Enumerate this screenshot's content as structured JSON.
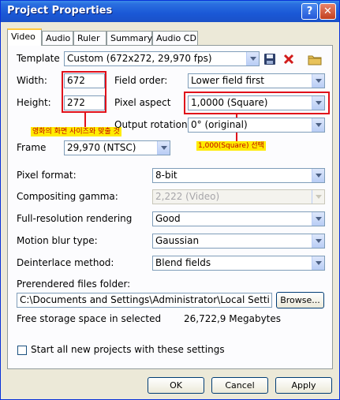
{
  "window": {
    "title": "Project Properties",
    "help_glyph": "?",
    "close_glyph": "✕"
  },
  "tabs": [
    "Video",
    "Audio",
    "Ruler",
    "Summary",
    "Audio CD"
  ],
  "template": {
    "label": "Template",
    "value": "Custom (672x272, 29,970 fps)"
  },
  "width": {
    "label": "Width:",
    "value": "672"
  },
  "height": {
    "label": "Height:",
    "value": "272"
  },
  "field_order": {
    "label": "Field order:",
    "value": "Lower field first"
  },
  "pixel_aspect": {
    "label": "Pixel aspect",
    "value": "1,0000 (Square)"
  },
  "output_rotation": {
    "label": "Output rotation:",
    "value": "0° (original)"
  },
  "frame": {
    "label": "Frame",
    "value": "29,970 (NTSC)"
  },
  "pixel_format": {
    "label": "Pixel format:",
    "value": "8-bit"
  },
  "compositing_gamma": {
    "label": "Compositing gamma:",
    "value": "2,222 (Video)"
  },
  "full_resolution": {
    "label": "Full-resolution rendering",
    "value": "Good"
  },
  "motion_blur": {
    "label": "Motion blur type:",
    "value": "Gaussian"
  },
  "deinterlace": {
    "label": "Deinterlace method:",
    "value": "Blend fields"
  },
  "prerendered": {
    "label": "Prerendered files folder:",
    "value": "C:\\Documents and Settings\\Administrator\\Local Setti",
    "browse": "Browse..."
  },
  "storage": {
    "label": "Free storage space in selected",
    "value": "26,722,9 Megabytes"
  },
  "start_all": {
    "label": "Start all new projects with these settings"
  },
  "buttons": {
    "ok": "OK",
    "cancel": "Cancel",
    "apply": "Apply"
  },
  "annotations": {
    "size_note": "영화의 화면 사이즈와 맞출 것",
    "aspect_note": "1,000(Square) 선택"
  },
  "colors": {
    "annotation_red": "#e0101a",
    "annotation_yellow": "#ffeb00",
    "title_blue": "#1a58d6"
  },
  "icons": [
    "save-icon",
    "delete-icon",
    "folder-icon"
  ]
}
